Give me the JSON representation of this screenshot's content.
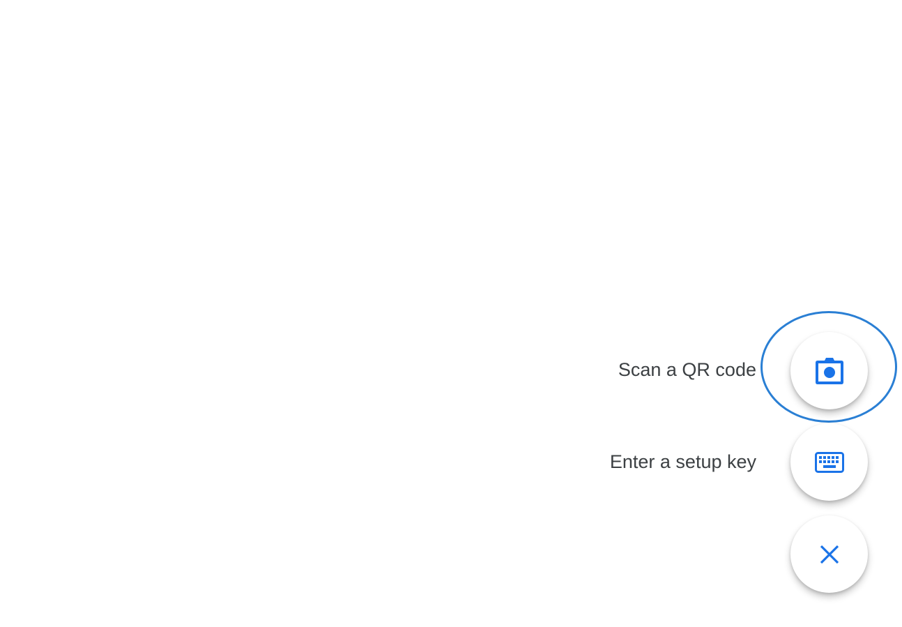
{
  "speed_dial": {
    "items": [
      {
        "label": "Scan a QR code",
        "icon": "camera-icon"
      },
      {
        "label": "Enter a setup key",
        "icon": "keyboard-icon"
      }
    ],
    "close_icon": "close-icon"
  },
  "colors": {
    "accent": "#1a73e8",
    "label_text": "#3c4043",
    "highlight_ring": "#2a7fd4",
    "background": "#ffffff"
  }
}
